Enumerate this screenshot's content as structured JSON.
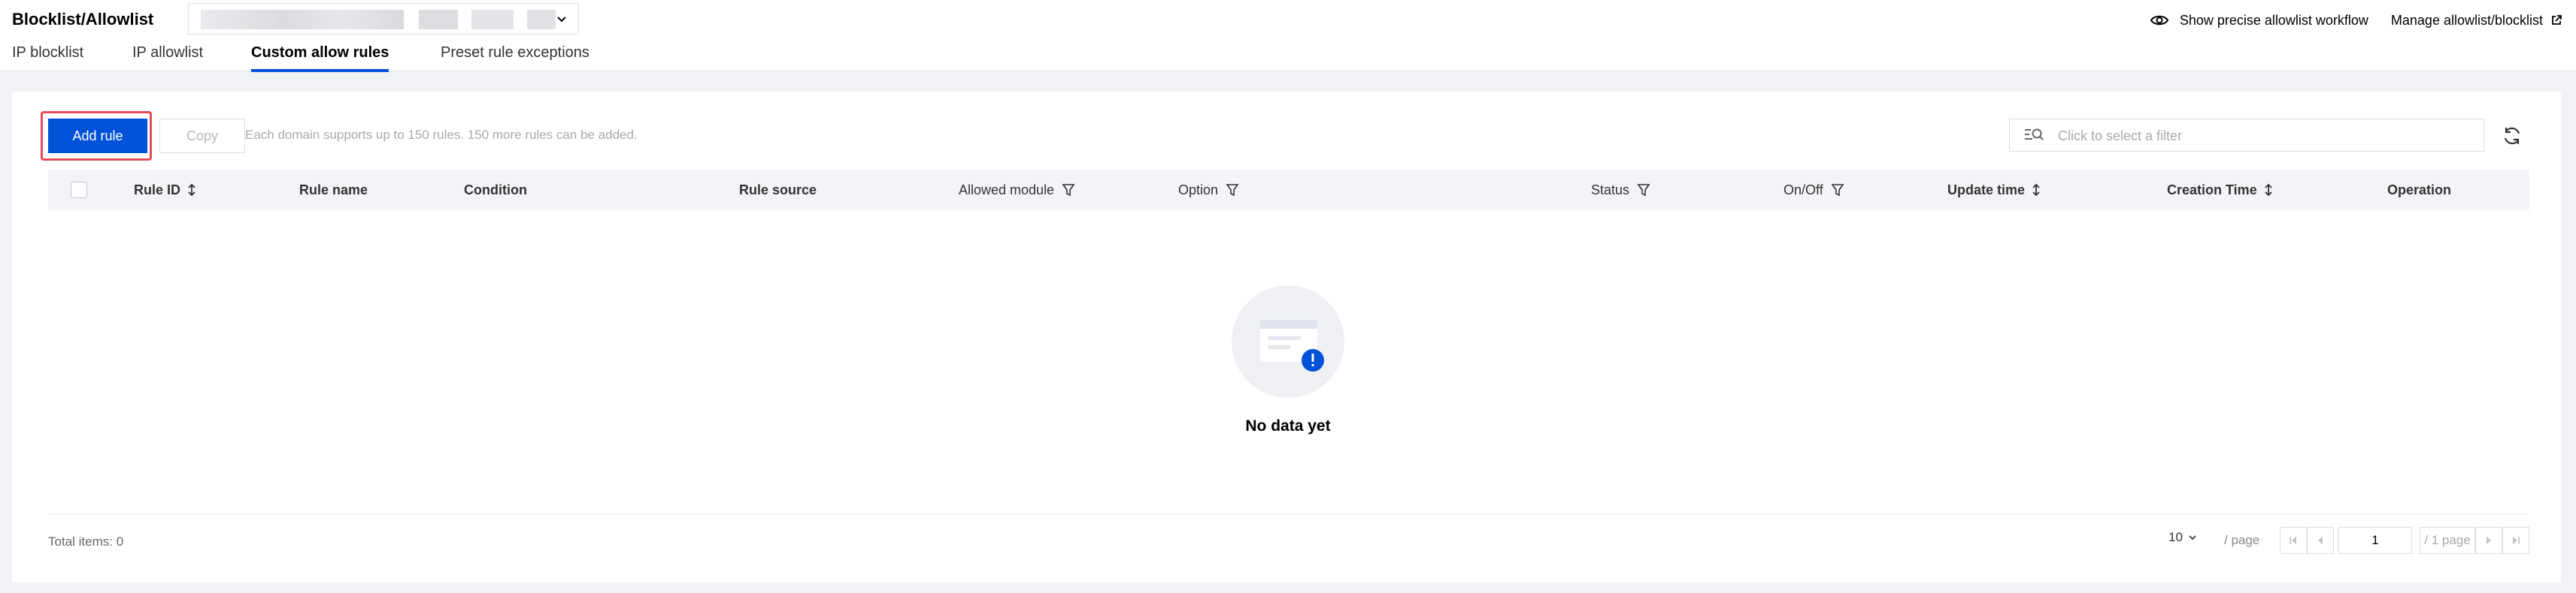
{
  "header": {
    "title": "Blocklist/Allowlist",
    "domain_selector": {
      "value": ""
    },
    "tabs": [
      {
        "label": "IP blocklist",
        "active": false
      },
      {
        "label": "IP allowlist",
        "active": false
      },
      {
        "label": "Custom allow rules",
        "active": true
      },
      {
        "label": "Preset rule exceptions",
        "active": false
      }
    ],
    "actions": {
      "workflow": {
        "label": "Show precise allowlist workflow",
        "icon": "eye-icon"
      },
      "manage": {
        "label": "Manage allowlist/blocklist",
        "icon": "external-link-icon"
      }
    }
  },
  "toolbar": {
    "add_label": "Add rule",
    "copy_label": "Copy",
    "hint": "Each domain supports up to 150 rules. 150 more rules can be added.",
    "filter_placeholder": "Click to select a filter",
    "refresh_icon": "refresh-icon"
  },
  "table": {
    "columns": [
      {
        "label": "Rule ID",
        "icon": "sort-icon"
      },
      {
        "label": "Rule name"
      },
      {
        "label": "Condition"
      },
      {
        "label": "Rule source"
      },
      {
        "label": "Allowed module",
        "icon": "filter-icon"
      },
      {
        "label": "Option",
        "icon": "filter-icon"
      },
      {
        "label": "Status",
        "icon": "filter-icon"
      },
      {
        "label": "On/Off",
        "icon": "filter-icon"
      },
      {
        "label": "Update time",
        "icon": "sort-icon"
      },
      {
        "label": "Creation Time",
        "icon": "sort-icon"
      },
      {
        "label": "Operation"
      }
    ],
    "rows": [],
    "empty_text": "No data yet"
  },
  "pagination": {
    "total_text": "Total items: 0",
    "page_size": "10",
    "per_page_label": "/ page",
    "current_page": "1",
    "total_pages_text": "/ 1 page"
  },
  "colors": {
    "primary": "#0052d9",
    "highlight": "#e34d59",
    "page_bg": "#f1f2f5"
  }
}
